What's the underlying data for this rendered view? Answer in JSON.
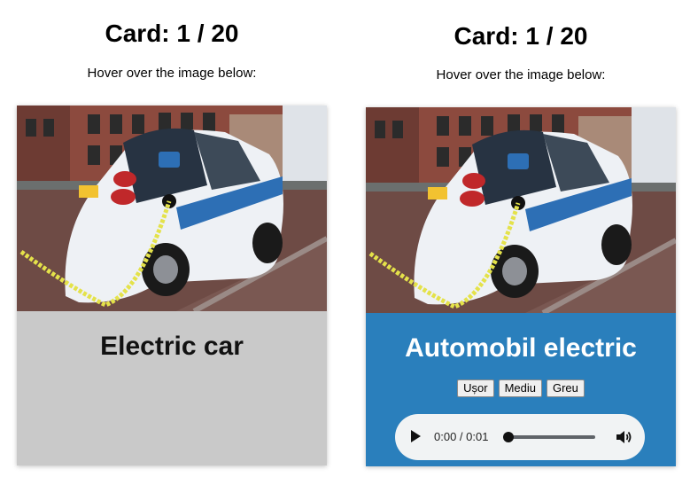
{
  "left_panel": {
    "title": "Card: 1 / 20",
    "hint": "Hover over the image below:",
    "card": {
      "label": "Electric car",
      "image_alt": "electric car"
    }
  },
  "right_panel": {
    "title": "Card: 1 / 20",
    "hint": "Hover over the image below:",
    "card": {
      "label": "Automobil electric",
      "image_alt": "electric car",
      "difficulty_buttons": [
        "Ușor",
        "Mediu",
        "Greu"
      ],
      "audio": {
        "time": "0:00 / 0:01",
        "progress": 0
      }
    }
  },
  "colors": {
    "front_card_bg": "#c9c9c9",
    "back_card_bg": "#2a7fbc",
    "player_bg": "#f1f3f4"
  },
  "icons": [
    "play-icon",
    "volume-icon"
  ]
}
